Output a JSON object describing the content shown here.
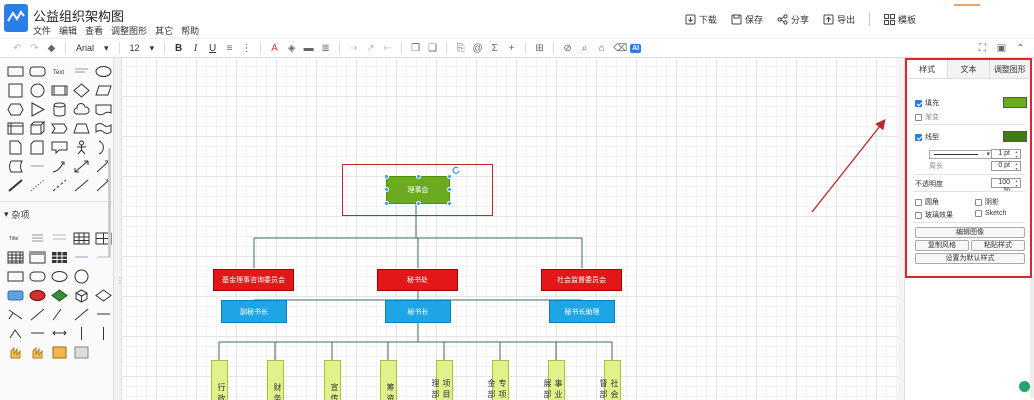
{
  "app": {
    "title": "公益组织架构图"
  },
  "menu": [
    "文件",
    "编辑",
    "查看",
    "调整图形",
    "其它",
    "帮助"
  ],
  "actions": {
    "download": "下载",
    "save": "保存",
    "share": "分享",
    "export": "导出",
    "template": "模板"
  },
  "toolbar": {
    "font": "Arial",
    "size": "12",
    "bold": "B",
    "italic": "I",
    "underline": "U",
    "ai": "AI"
  },
  "sidebar": {
    "misc_section": "杂项",
    "text_shape": "Text"
  },
  "diagram": {
    "root": "理事会",
    "level1": [
      "基金理事咨询委员会",
      "秘书处",
      "社会监督委员会"
    ],
    "level2": [
      "副秘书长",
      "秘书长",
      "秘书长助理"
    ],
    "leaves": [
      "行政部",
      "财务部",
      "宣传部",
      "筹资部",
      "项目管理部",
      "专项基金部",
      "事业发展部",
      "社会监督部"
    ]
  },
  "format_panel": {
    "tabs": [
      "样式",
      "文本",
      "调整图形"
    ],
    "fill_label": "填充",
    "gradient_label": "渐变",
    "line_label": "线型",
    "line_width": "1 pt",
    "perimeter_label": "周长",
    "perimeter_value": "0 pt",
    "opacity_label": "不透明度",
    "opacity_value": "100 %",
    "rounded_label": "圆角",
    "shadow_label": "阴影",
    "glass_label": "玻璃效果",
    "sketch_label": "Sketch",
    "edit_image": "编辑图像",
    "copy_style": "复制风格",
    "paste_style": "粘贴样式",
    "set_default": "设置为默认样式",
    "fill_color": "#6aab1f",
    "line_color": "#3a7d12"
  },
  "colors": {
    "accent": "#2b7de9",
    "highlight": "#c1272d"
  }
}
